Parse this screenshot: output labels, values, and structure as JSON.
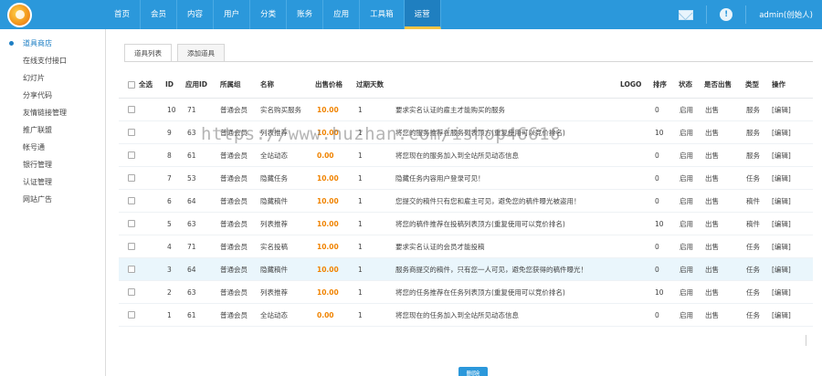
{
  "nav": {
    "items": [
      "首页",
      "会员",
      "内容",
      "用户",
      "分类",
      "账务",
      "应用",
      "工具箱",
      "运营"
    ],
    "active_index": 8
  },
  "top_right": {
    "user": "admin(创始人)"
  },
  "sidebar": {
    "items": [
      "道具商店",
      "在线支付接口",
      "幻灯片",
      "分享代码",
      "友情链接管理",
      "推广联盟",
      "帐号通",
      "银行管理",
      "认证管理",
      "网站广告"
    ],
    "active_index": 0
  },
  "tabs": [
    "道具列表",
    "添加道具"
  ],
  "table": {
    "headers": {
      "select_all": "全选",
      "id": "ID",
      "app_id": "应用ID",
      "group": "所属组",
      "name": "名称",
      "price": "出售价格",
      "days": "过期天数",
      "desc": "",
      "logo": "LOGO",
      "sort": "排序",
      "status": "状态",
      "sale": "是否出售",
      "type": "类型",
      "action": "操作"
    },
    "rows": [
      {
        "id": "10",
        "app_id": "71",
        "group": "普通会员",
        "name": "实名购买服务",
        "price": "10.00",
        "days": "1",
        "desc": "要求实名认证的雇主才能购买的服务",
        "sort": "0",
        "status": "启用",
        "sale": "出售",
        "type": "服务",
        "action": "[编辑]"
      },
      {
        "id": "9",
        "app_id": "63",
        "group": "普通会员",
        "name": "列表推荐",
        "price": "10.00",
        "days": "1",
        "desc": "将您的服务推荐在服务列表顶方(重复使用可以竞价排名)",
        "sort": "10",
        "status": "启用",
        "sale": "出售",
        "type": "服务",
        "action": "[编辑]"
      },
      {
        "id": "8",
        "app_id": "61",
        "group": "普通会员",
        "name": "全站动态",
        "price": "0.00",
        "days": "1",
        "desc": "将您现在的服务加入到全站所见动态信息",
        "sort": "0",
        "status": "启用",
        "sale": "出售",
        "type": "服务",
        "action": "[编辑]"
      },
      {
        "id": "7",
        "app_id": "53",
        "group": "普通会员",
        "name": "隐藏任务",
        "price": "10.00",
        "days": "1",
        "desc": "隐藏任务内容用户登录可见！",
        "sort": "0",
        "status": "启用",
        "sale": "出售",
        "type": "任务",
        "action": "[编辑]"
      },
      {
        "id": "6",
        "app_id": "64",
        "group": "普通会员",
        "name": "隐藏稿件",
        "price": "10.00",
        "days": "1",
        "desc": "您提交的稿件只有您和雇主可见，避免您的稿件曝光被盗用！",
        "sort": "0",
        "status": "启用",
        "sale": "出售",
        "type": "稿件",
        "action": "[编辑]"
      },
      {
        "id": "5",
        "app_id": "63",
        "group": "普通会员",
        "name": "列表推荐",
        "price": "10.00",
        "days": "1",
        "desc": "将您的稿件推荐在投稿列表顶方(重复使用可以竞价排名)",
        "sort": "10",
        "status": "启用",
        "sale": "出售",
        "type": "稿件",
        "action": "[编辑]"
      },
      {
        "id": "4",
        "app_id": "71",
        "group": "普通会员",
        "name": "实名投稿",
        "price": "10.00",
        "days": "1",
        "desc": "要求实名认证的会员才能投稿",
        "sort": "0",
        "status": "启用",
        "sale": "出售",
        "type": "任务",
        "action": "[编辑]"
      },
      {
        "id": "3",
        "app_id": "64",
        "group": "普通会员",
        "name": "隐藏稿件",
        "price": "10.00",
        "days": "1",
        "desc": "服务商提交的稿件，只有您一人可见，避免您获得的稿件曝光！",
        "sort": "0",
        "status": "启用",
        "sale": "出售",
        "type": "任务",
        "action": "[编辑]"
      },
      {
        "id": "2",
        "app_id": "63",
        "group": "普通会员",
        "name": "列表推荐",
        "price": "10.00",
        "days": "1",
        "desc": "将您的任务推荐在任务列表顶方(重复使用可以竞价排名)",
        "sort": "10",
        "status": "启用",
        "sale": "出售",
        "type": "任务",
        "action": "[编辑]"
      },
      {
        "id": "1",
        "app_id": "61",
        "group": "普通会员",
        "name": "全站动态",
        "price": "0.00",
        "days": "1",
        "desc": "将您现在的任务加入到全站所见动态信息",
        "sort": "0",
        "status": "启用",
        "sale": "出售",
        "type": "任务",
        "action": "[编辑]"
      }
    ]
  },
  "delete_label": "删除",
  "watermark": "https://www.huzhan.com/ishop46616",
  "colors": {
    "topbar": "#2b98db",
    "price": "#f08300",
    "active_link": "#1e7fc4"
  }
}
